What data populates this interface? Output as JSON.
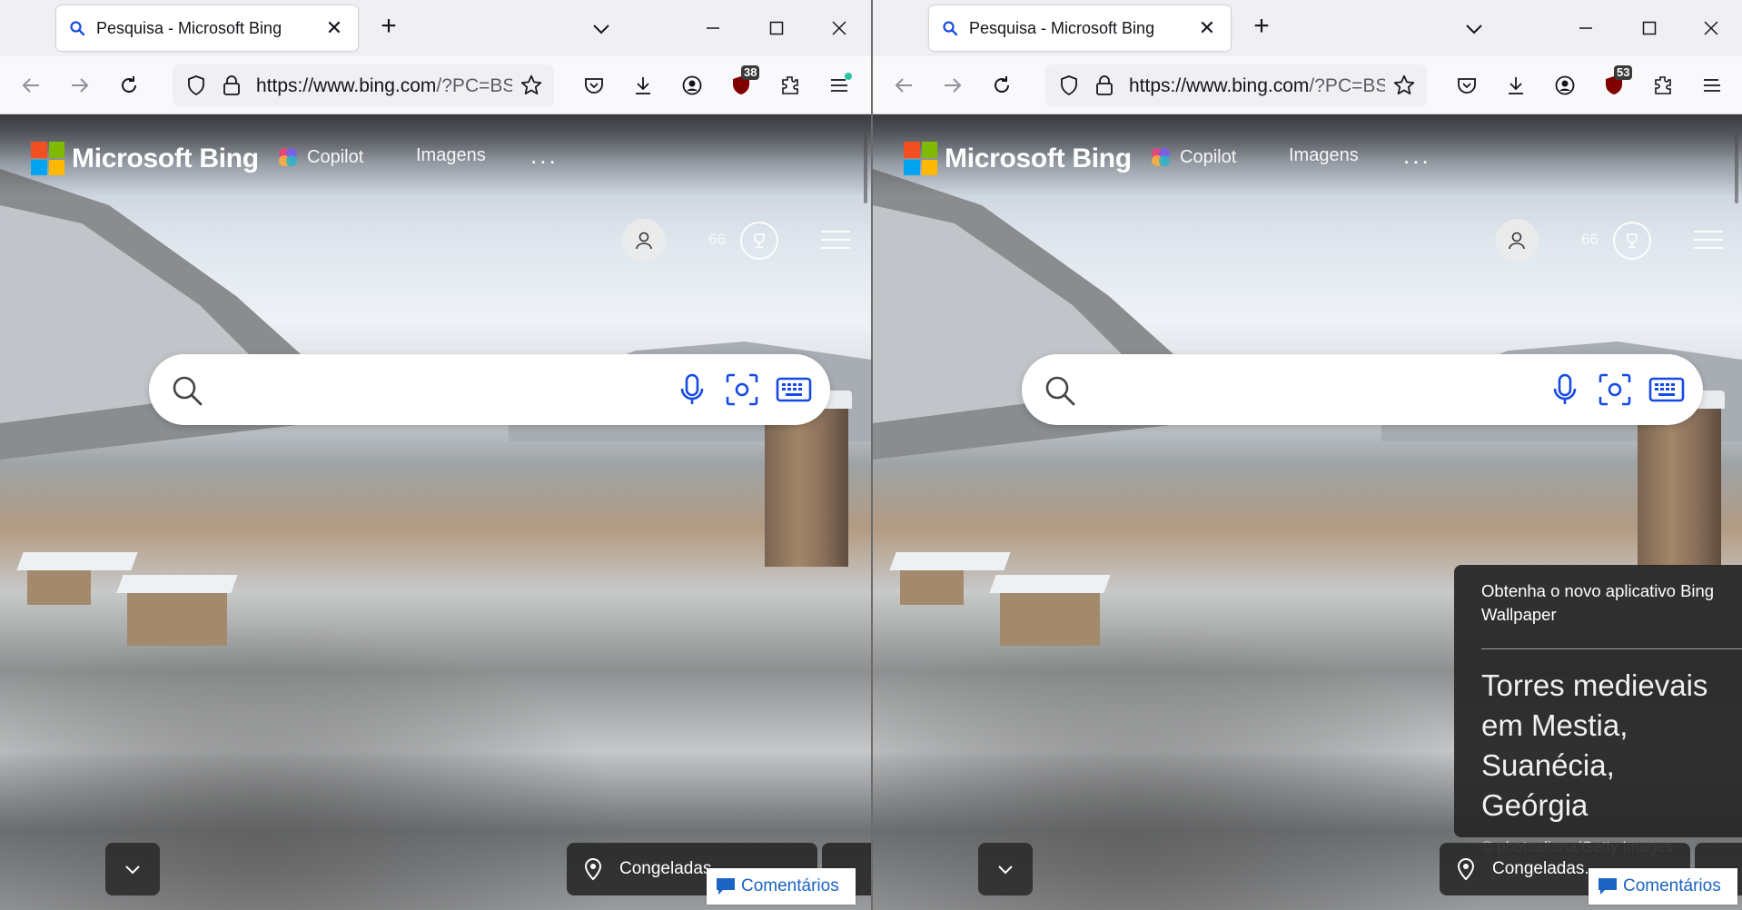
{
  "windows": [
    {
      "tab_title": "Pesquisa - Microsoft Bing",
      "url_host": "https://www.bing.com",
      "url_rest": "/?PC=BS",
      "ublock_count": "38",
      "bing": {
        "logo_text": "Microsoft Bing",
        "nav_copilot": "Copilot",
        "nav_images": "Imagens",
        "nav_more": "...",
        "points": "66",
        "location_label": "Congeladas...",
        "feedback_label": "Comentários"
      }
    },
    {
      "tab_title": "Pesquisa - Microsoft Bing",
      "url_host": "https://www.bing.com",
      "url_rest": "/?PC=BS",
      "ublock_count": "53",
      "bing": {
        "logo_text": "Microsoft Bing",
        "nav_copilot": "Copilot",
        "nav_images": "Imagens",
        "nav_more": "...",
        "points": "66",
        "location_label": "Congeladas...",
        "feedback_label": "Comentários"
      },
      "info_card": {
        "promo": "Obtenha o novo aplicativo Bing Wallpaper",
        "title": "Torres medievais em Mestia, Suanécia, Geórgia",
        "credit": "© photoaliona/Getty Images"
      }
    }
  ],
  "colors": {
    "ms_red": "#f25022",
    "ms_green": "#7fba00",
    "ms_blue": "#00a4ef",
    "ms_yellow": "#ffb900",
    "feedback_blue": "#1b64c3",
    "bing_blue": "#174ae4"
  },
  "icons": [
    "search-icon",
    "close-icon",
    "plus-icon",
    "chevron-down-icon",
    "minimize-icon",
    "maximize-icon",
    "back-icon",
    "forward-icon",
    "reload-icon",
    "shield-icon",
    "lock-icon",
    "star-icon",
    "pocket-icon",
    "download-icon",
    "account-icon",
    "ublock-icon",
    "extensions-icon",
    "menu-icon",
    "microphone-icon",
    "visual-search-icon",
    "keyboard-icon",
    "user-icon",
    "trophy-icon",
    "location-pin-icon",
    "comment-icon"
  ]
}
